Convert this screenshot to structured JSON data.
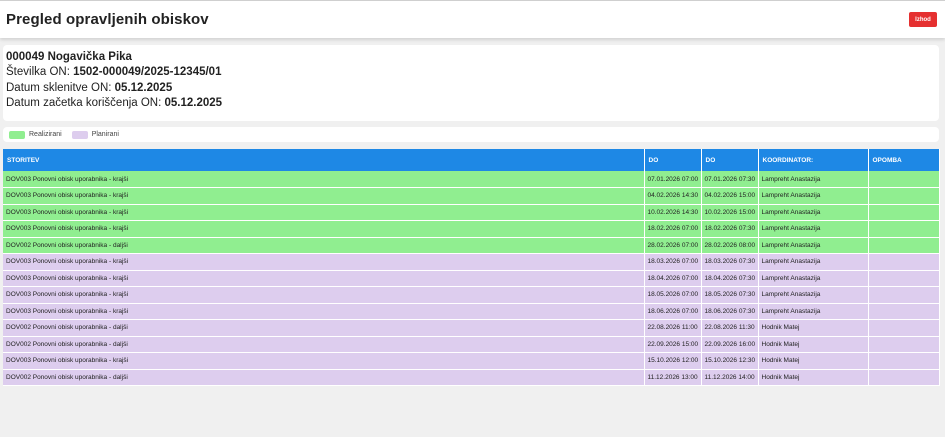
{
  "header": {
    "title": "Pregled opravljenih obiskov",
    "exit_label": "Izhod"
  },
  "info": {
    "name": "000049 Nogavička Pika",
    "contract_label": "Številka ON: ",
    "contract_value": "1502-000049/2025-12345/01",
    "concluded_label": "Datum sklenitve ON: ",
    "concluded_value": "05.12.2025",
    "start_label": "Datum začetka koriščenja ON: ",
    "start_value": "05.12.2025"
  },
  "legend": {
    "done_label": "Realizirani",
    "planned_label": "Planirani"
  },
  "colors": {
    "header_bar": "#1e88e5",
    "done": "#90ee90",
    "planned": "#ddcdee",
    "exit_button": "#e53030"
  },
  "table": {
    "columns": [
      "STORITEV",
      "DO",
      "DO",
      "KOORDINATOR:",
      "OPOMBA"
    ],
    "rows": [
      {
        "status": "done",
        "service": "DOV003 Ponovni obisk uporabnika - krajši",
        "from": "07.01.2026 07:00",
        "to": "07.01.2026 07:30",
        "coordinator": "Lampreht Anastazija",
        "note": ""
      },
      {
        "status": "done",
        "service": "DOV003 Ponovni obisk uporabnika - krajši",
        "from": "04.02.2026 14:30",
        "to": "04.02.2026 15:00",
        "coordinator": "Lampreht Anastazija",
        "note": ""
      },
      {
        "status": "done",
        "service": "DOV003 Ponovni obisk uporabnika - krajši",
        "from": "10.02.2026 14:30",
        "to": "10.02.2026 15:00",
        "coordinator": "Lampreht Anastazija",
        "note": ""
      },
      {
        "status": "done",
        "service": "DOV003 Ponovni obisk uporabnika - krajši",
        "from": "18.02.2026 07:00",
        "to": "18.02.2026 07:30",
        "coordinator": "Lampreht Anastazija",
        "note": ""
      },
      {
        "status": "done",
        "service": "DOV002 Ponovni obisk uporabnika - daljši",
        "from": "28.02.2026 07:00",
        "to": "28.02.2026 08:00",
        "coordinator": "Lampreht Anastazija",
        "note": ""
      },
      {
        "status": "plan",
        "service": "DOV003 Ponovni obisk uporabnika - krajši",
        "from": "18.03.2026 07:00",
        "to": "18.03.2026 07:30",
        "coordinator": "Lampreht Anastazija",
        "note": ""
      },
      {
        "status": "plan",
        "service": "DOV003 Ponovni obisk uporabnika - krajši",
        "from": "18.04.2026 07:00",
        "to": "18.04.2026 07:30",
        "coordinator": "Lampreht Anastazija",
        "note": ""
      },
      {
        "status": "plan",
        "service": "DOV003 Ponovni obisk uporabnika - krajši",
        "from": "18.05.2026 07:00",
        "to": "18.05.2026 07:30",
        "coordinator": "Lampreht Anastazija",
        "note": ""
      },
      {
        "status": "plan",
        "service": "DOV003 Ponovni obisk uporabnika - krajši",
        "from": "18.06.2026 07:00",
        "to": "18.06.2026 07:30",
        "coordinator": "Lampreht Anastazija",
        "note": ""
      },
      {
        "status": "plan",
        "service": "DOV002 Ponovni obisk uporabnika - daljši",
        "from": "22.08.2026 11:00",
        "to": "22.08.2026 11:30",
        "coordinator": "Hodnik Matej",
        "note": ""
      },
      {
        "status": "plan",
        "service": "DOV002 Ponovni obisk uporabnika - daljši",
        "from": "22.09.2026 15:00",
        "to": "22.09.2026 16:00",
        "coordinator": "Hodnik Matej",
        "note": ""
      },
      {
        "status": "plan",
        "service": "DOV003 Ponovni obisk uporabnika - krajši",
        "from": "15.10.2026 12:00",
        "to": "15.10.2026 12:30",
        "coordinator": "Hodnik Matej",
        "note": ""
      },
      {
        "status": "plan",
        "service": "DOV002 Ponovni obisk uporabnika - daljši",
        "from": "11.12.2026 13:00",
        "to": "11.12.2026 14:00",
        "coordinator": "Hodnik Matej",
        "note": ""
      }
    ]
  }
}
